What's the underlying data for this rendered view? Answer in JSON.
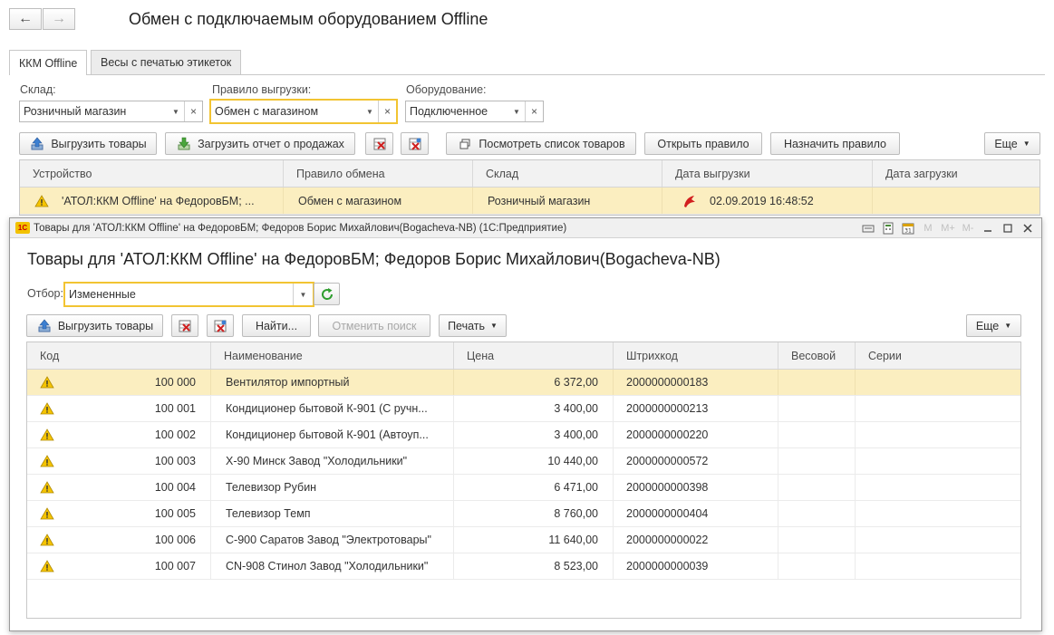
{
  "window": {
    "title": "Обмен с подключаемым оборудованием Offline",
    "back_icon": "←",
    "forward_icon": "→"
  },
  "tabs": [
    {
      "label": "ККМ Offline",
      "active": true
    },
    {
      "label": "Весы с печатью этикеток",
      "active": false
    }
  ],
  "filters": {
    "warehouse": {
      "label": "Склад:",
      "value": "Розничный магазин"
    },
    "rule": {
      "label": "Правило выгрузки:",
      "value": "Обмен с магазином"
    },
    "equipment": {
      "label": "Оборудование:",
      "value": "Подключенное"
    }
  },
  "toolbar": {
    "upload_goods": "Выгрузить товары",
    "load_report": "Загрузить отчет о продажах",
    "view_goods_list": "Посмотреть список товаров",
    "open_rule": "Открыть правило",
    "assign_rule": "Назначить правило",
    "more": "Еще"
  },
  "devices_table": {
    "columns": [
      "Устройство",
      "Правило обмена",
      "Склад",
      "Дата выгрузки",
      "Дата загрузки"
    ],
    "rows": [
      {
        "device": "'АТОЛ:ККМ Offline' на ФедоровБМ; ...",
        "rule": "Обмен с магазином",
        "warehouse": "Розничный магазин",
        "upload_date": "02.09.2019 16:48:52",
        "load_date": ""
      }
    ]
  },
  "subwindow": {
    "titlebar": "Товары для 'АТОЛ:ККМ Offline' на ФедоровБМ; Федоров Борис Михайлович(Bogacheva-NB)  (1С:Предприятие)",
    "logo": "1С",
    "heading": "Товары для 'АТОЛ:ККМ Offline' на ФедоровБМ; Федоров Борис Михайлович(Bogacheva-NB)",
    "titlebar_icons": {
      "m": "M",
      "mplus": "M+",
      "mminus": "M-"
    },
    "filter": {
      "label": "Отбор:",
      "value": "Измененные"
    },
    "toolbar": {
      "upload_goods": "Выгрузить товары",
      "find": "Найти...",
      "cancel_search": "Отменить поиск",
      "print": "Печать",
      "more": "Еще"
    },
    "goods_table": {
      "columns": [
        "Код",
        "Наименование",
        "Цена",
        "Штрихкод",
        "Весовой",
        "Серии"
      ],
      "rows": [
        {
          "code": "100 000",
          "name": "Вентилятор импортный",
          "price": "6 372,00",
          "barcode": "2000000000183"
        },
        {
          "code": "100 001",
          "name": "Кондиционер бытовой К-901 (С ручн...",
          "price": "3 400,00",
          "barcode": "2000000000213"
        },
        {
          "code": "100 002",
          "name": "Кондиционер бытовой К-901 (Автоуп...",
          "price": "3 400,00",
          "barcode": "2000000000220"
        },
        {
          "code": "100 003",
          "name": "Х-90 Минск Завод \"Холодильники\"",
          "price": "10 440,00",
          "barcode": "2000000000572"
        },
        {
          "code": "100 004",
          "name": "Телевизор Рубин",
          "price": "6 471,00",
          "barcode": "2000000000398"
        },
        {
          "code": "100 005",
          "name": "Телевизор Темп",
          "price": "8 760,00",
          "barcode": "2000000000404"
        },
        {
          "code": "100 006",
          "name": "С-900 Саратов Завод \"Электротовары\"",
          "price": "11 640,00",
          "barcode": "2000000000022"
        },
        {
          "code": "100 007",
          "name": "CN-908 Стинол Завод \"Холодильники\"",
          "price": "8 523,00",
          "barcode": "2000000000039"
        }
      ]
    }
  },
  "colors": {
    "selection": "#fbeec0",
    "focus_border": "#f2c432",
    "accent_green": "#2e9d2e"
  }
}
